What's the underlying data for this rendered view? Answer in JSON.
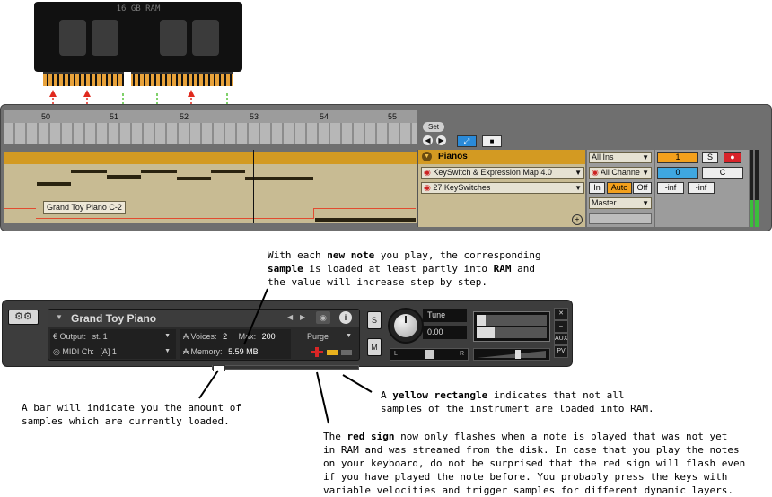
{
  "ram": {
    "label": "16 GB RAM"
  },
  "ruler": {
    "bars": [
      "50",
      "51",
      "52",
      "53",
      "54",
      "55"
    ]
  },
  "transport": {
    "set_label": "Set"
  },
  "clip": {
    "label": "Grand Toy Piano C-2"
  },
  "instrument": {
    "name": "Pianos",
    "map": "KeySwitch & Expression Map 4.0",
    "program": "27 KeySwitches"
  },
  "routing": {
    "input": "All Ins",
    "channel": "All Channe",
    "in_label": "In",
    "auto_label": "Auto",
    "off_label": "Off",
    "output": "Master"
  },
  "mixer": {
    "channel_num": "1",
    "solo": "S",
    "pan_value": "0",
    "pan_label": "C",
    "level_left": "-inf",
    "level_right": "-inf"
  },
  "kontakt": {
    "title": "Grand Toy Piano",
    "output_label": "Output:",
    "output_value": "st. 1",
    "voices_label": "Voices:",
    "voices_value": "2",
    "max_label": "Max:",
    "max_value": "200",
    "purge_label": "Purge",
    "midi_label": "MIDI Ch:",
    "midi_value": "[A]  1",
    "memory_label": "Memory:",
    "memory_value": "5.59 MB",
    "solo": "S",
    "mute": "M",
    "tune_label": "Tune",
    "tune_value": "0.00",
    "pan_left": "L",
    "pan_right": "R",
    "aux": "AUX",
    "pv": "PV"
  },
  "annotations": {
    "new_note": {
      "l1a": "With each ",
      "l1b": "new note",
      "l1c": " you play, the corresponding",
      "l2a": "sample",
      "l2b": " is loaded at least partly into ",
      "l2c": "RAM",
      "l2d": " and",
      "l3": "the value will increase step by step."
    },
    "bar": {
      "l1": "A bar will indicate you the amount of",
      "l2": "samples which are currently loaded."
    },
    "yellow": {
      "l1a": "A ",
      "l1b": "yellow rectangle",
      "l1c": " indicates that not all",
      "l2": "samples of the instrument are loaded into RAM."
    },
    "red": {
      "l1a": "The ",
      "l1b": "red sign",
      "l1c": " now only flashes when a note is played that was not yet",
      "l2": "in RAM and was streamed from the disk. In case that you play the notes",
      "l3": "on your keyboard, do not be surprised that the red sign will flash even",
      "l4": "if you have played the note before. You probably press the keys with",
      "l5": "variable velocities and trigger samples for different dynamic layers."
    }
  }
}
